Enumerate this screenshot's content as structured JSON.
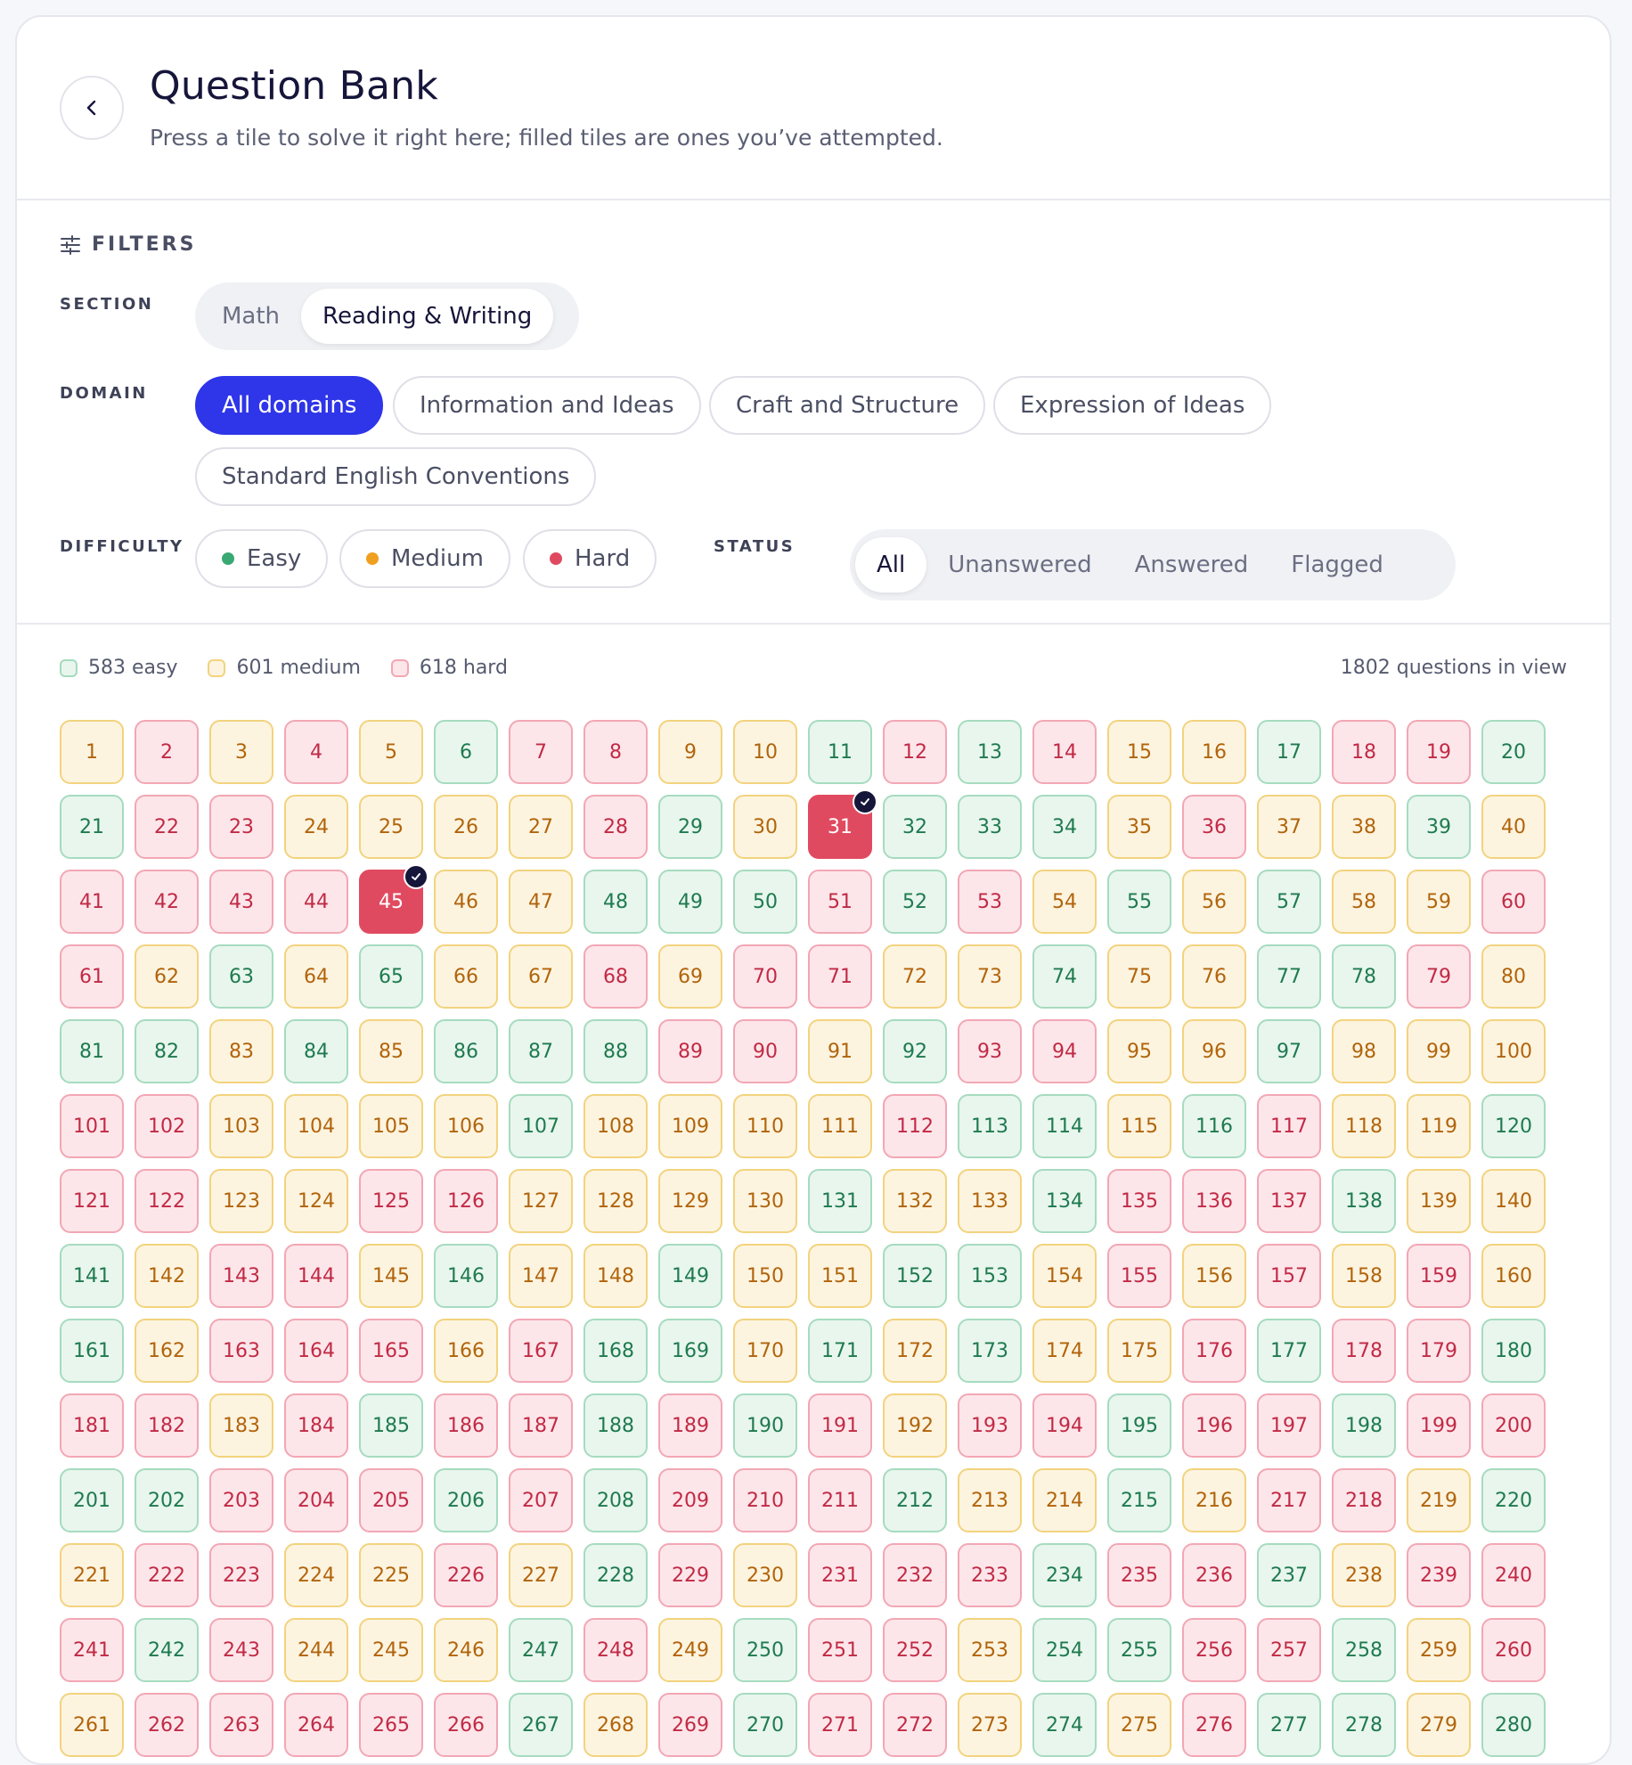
{
  "header": {
    "title": "Question Bank",
    "subtitle": "Press a tile to solve it right here; filled tiles are ones you’ve attempted."
  },
  "filters": {
    "heading": "FILTERS",
    "section": {
      "label": "SECTION",
      "options": [
        "Math",
        "Reading & Writing"
      ],
      "selected": "Reading & Writing"
    },
    "domain": {
      "label": "DOMAIN",
      "options": [
        "All domains",
        "Information and Ideas",
        "Craft and Structure",
        "Expression of Ideas",
        "Standard English Conventions"
      ],
      "selected": "All domains"
    },
    "difficulty": {
      "label": "DIFFICULTY",
      "options": [
        "Easy",
        "Medium",
        "Hard"
      ]
    },
    "status": {
      "label": "STATUS",
      "options": [
        "All",
        "Unanswered",
        "Answered",
        "Flagged"
      ],
      "selected": "All"
    }
  },
  "legend": {
    "easy": "583 easy",
    "medium": "601 medium",
    "hard": "618 hard",
    "count": "1802 questions in view"
  },
  "colors": {
    "easy": "#3aa872",
    "medium": "#f0a020",
    "hard": "#e04a60",
    "accent": "#2f35e8"
  },
  "tile_difficulty_key": {
    "e": "easy",
    "m": "medium",
    "h": "hard"
  },
  "tile_rows": [
    "mhmhmehhmmehehmmehhe",
    "ehhmmmmhemheeemhmmem",
    "hhhhhmmeeehehmememmh",
    "hmememmhmhhmmemmeehm",
    "eememeeehhmehhmmemmm",
    "hhmmmmemmmmheemehmme",
    "hhmmhhmmmmemmehhhemm",
    "emhhmemmemmeemhmhmhm",
    "emhhhmheemememmhehhe",
    "hhmhehhehehmhhehhehh",
    "eehhhehehhhemmemhhme",
    "mhhmmhmehmhhhehhemhh",
    "hehmmmehmehhmeehhemh",
    "mhhhhhemhehhmemheeme"
  ],
  "attempted": [
    31,
    45
  ]
}
